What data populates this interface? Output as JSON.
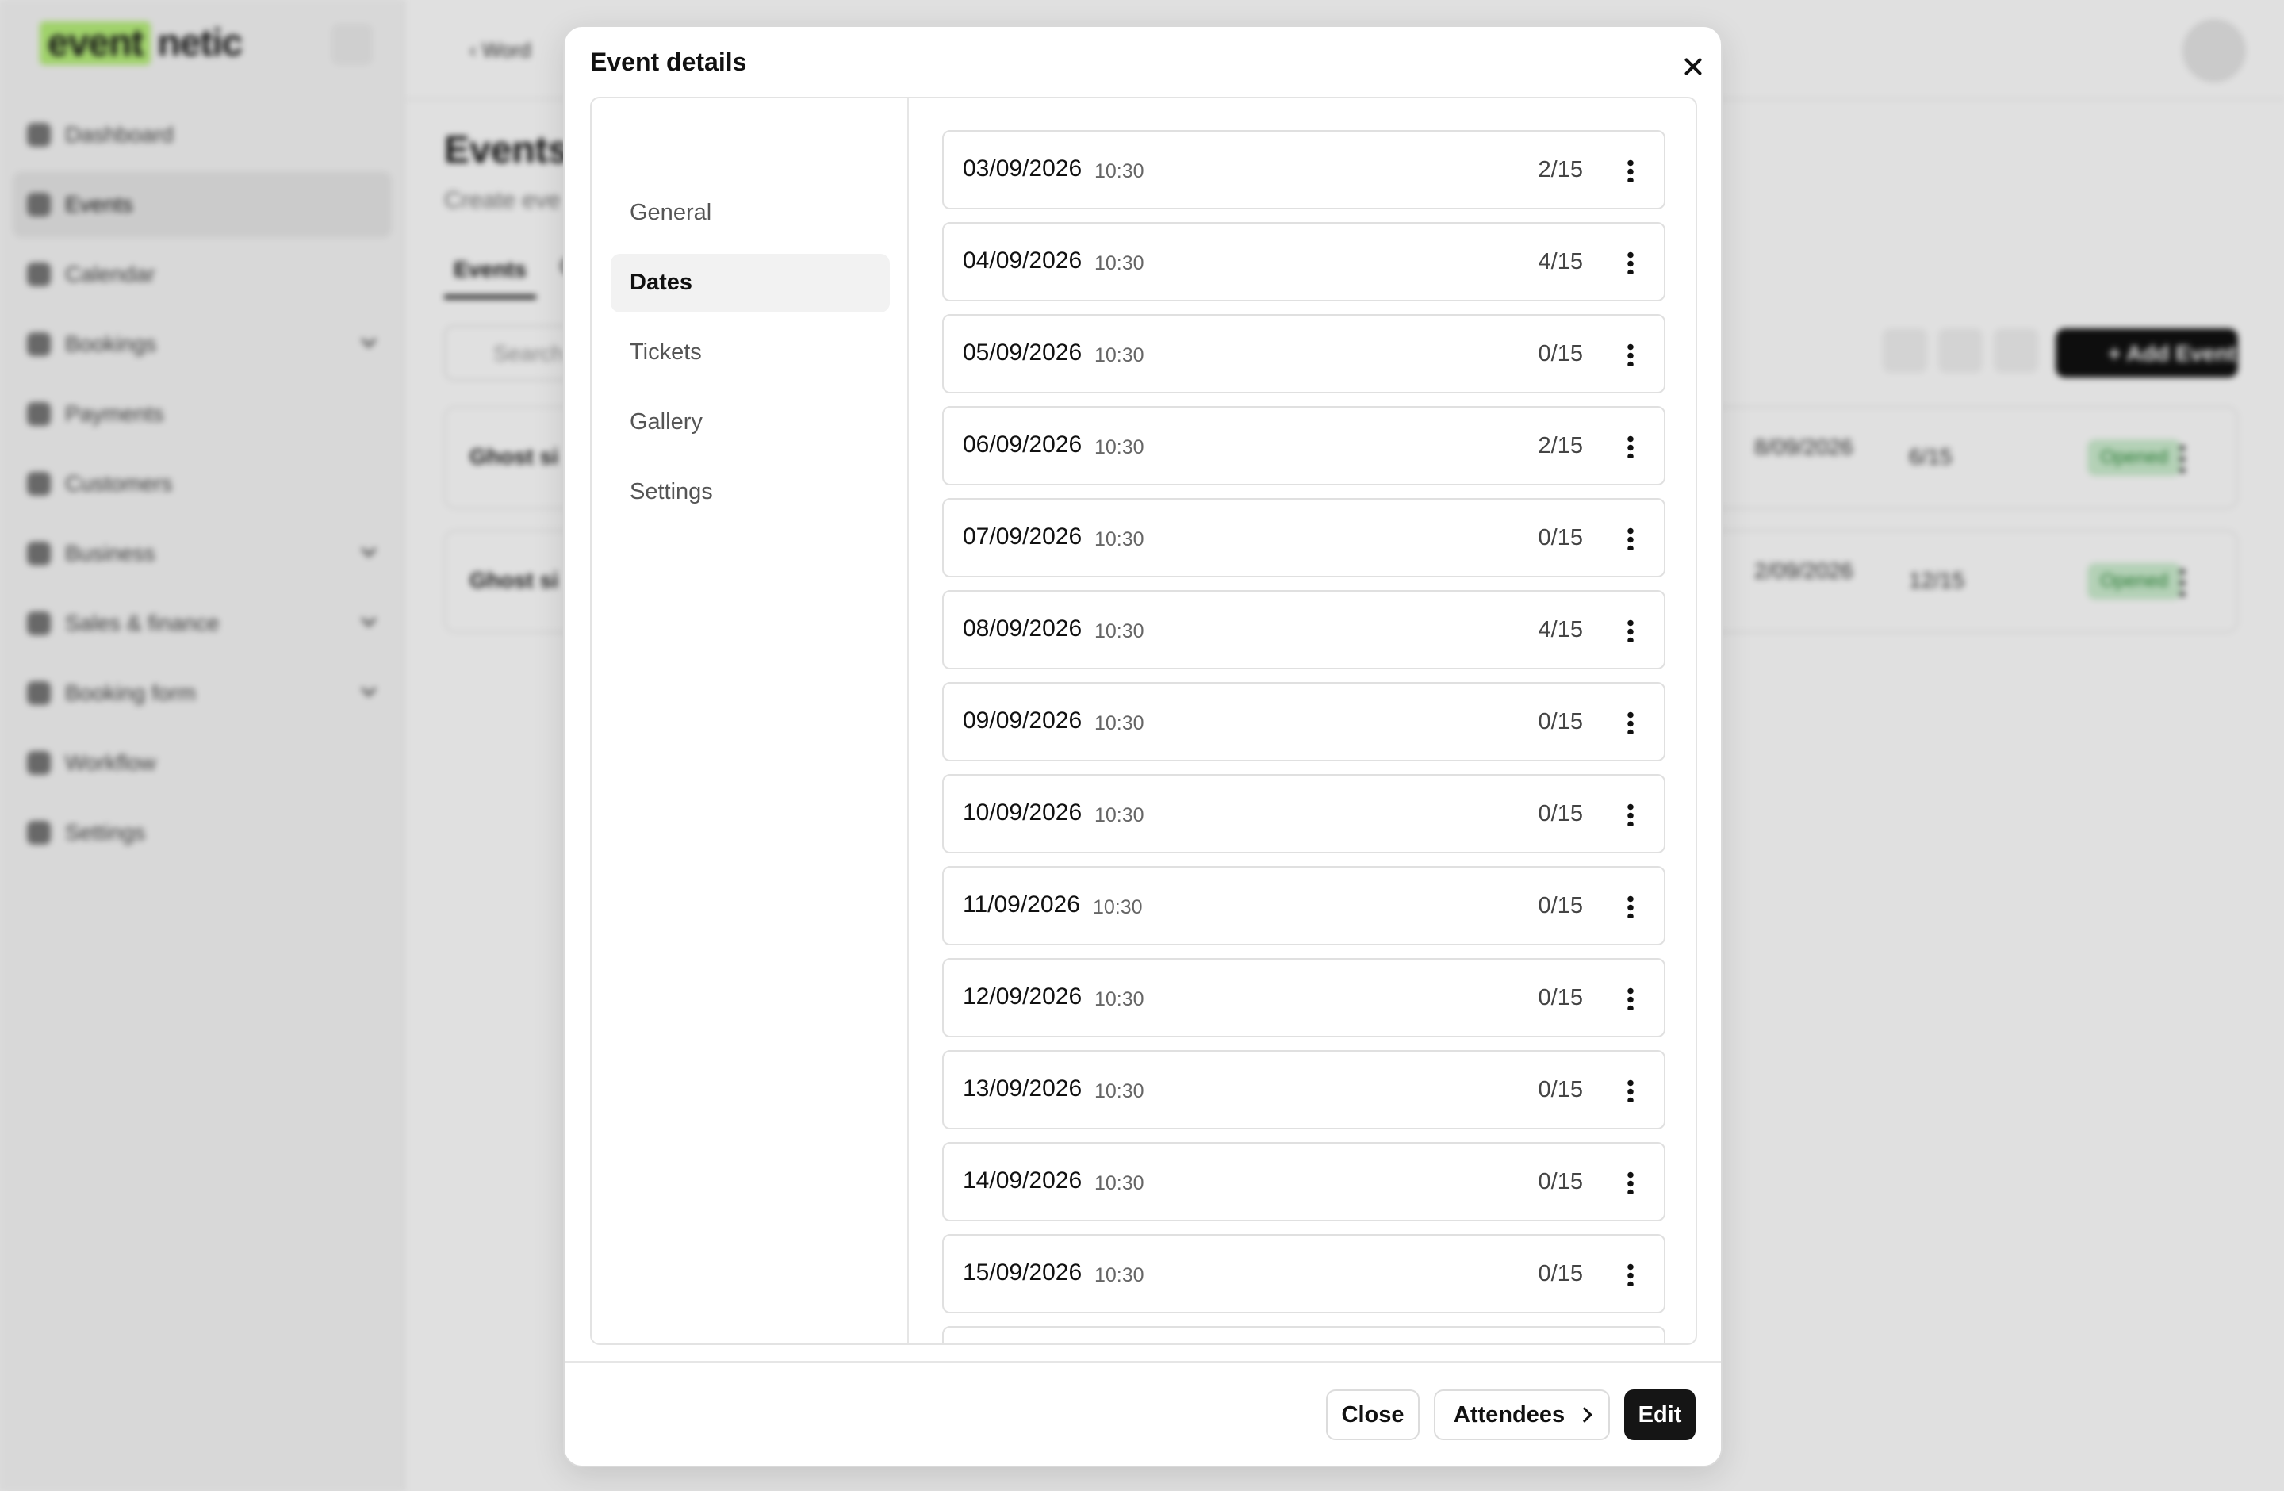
{
  "background": {
    "logo": {
      "part1": "event",
      "part2": "netic"
    },
    "nav": [
      {
        "label": "Dashboard"
      },
      {
        "label": "Events",
        "active": true
      },
      {
        "label": "Calendar"
      },
      {
        "label": "Bookings",
        "expandable": true
      },
      {
        "label": "Payments"
      },
      {
        "label": "Customers"
      },
      {
        "label": "Business",
        "expandable": true
      },
      {
        "label": "Sales & finance",
        "expandable": true
      },
      {
        "label": "Booking form",
        "expandable": true
      },
      {
        "label": "Workflow"
      },
      {
        "label": "Settings"
      }
    ],
    "breadcrumb": "Word",
    "page_title": "Events",
    "page_subtitle": "Create eve",
    "tabs": [
      "Events",
      "C"
    ],
    "search_placeholder": "Search",
    "add_button": "Add Event",
    "rows": [
      {
        "name": "Ghost si",
        "date": "8/09/2026",
        "capacity": "6/15",
        "status": "Opened"
      },
      {
        "name": "Ghost si",
        "date": "2/09/2026",
        "capacity": "12/15",
        "status": "Opened"
      }
    ]
  },
  "modal": {
    "title": "Event details",
    "tabs": [
      {
        "label": "General"
      },
      {
        "label": "Dates",
        "active": true
      },
      {
        "label": "Tickets"
      },
      {
        "label": "Gallery"
      },
      {
        "label": "Settings"
      }
    ],
    "dates": [
      {
        "date": "03/09/2026",
        "time": "10:30",
        "count": "2/15"
      },
      {
        "date": "04/09/2026",
        "time": "10:30",
        "count": "4/15"
      },
      {
        "date": "05/09/2026",
        "time": "10:30",
        "count": "0/15"
      },
      {
        "date": "06/09/2026",
        "time": "10:30",
        "count": "2/15"
      },
      {
        "date": "07/09/2026",
        "time": "10:30",
        "count": "0/15"
      },
      {
        "date": "08/09/2026",
        "time": "10:30",
        "count": "4/15"
      },
      {
        "date": "09/09/2026",
        "time": "10:30",
        "count": "0/15"
      },
      {
        "date": "10/09/2026",
        "time": "10:30",
        "count": "0/15"
      },
      {
        "date": "11/09/2026",
        "time": "10:30",
        "count": "0/15"
      },
      {
        "date": "12/09/2026",
        "time": "10:30",
        "count": "0/15"
      },
      {
        "date": "13/09/2026",
        "time": "10:30",
        "count": "0/15"
      },
      {
        "date": "14/09/2026",
        "time": "10:30",
        "count": "0/15"
      },
      {
        "date": "15/09/2026",
        "time": "10:30",
        "count": "0/15"
      }
    ],
    "footer": {
      "close_label": "Close",
      "attendees_label": "Attendees",
      "edit_label": "Edit"
    }
  }
}
